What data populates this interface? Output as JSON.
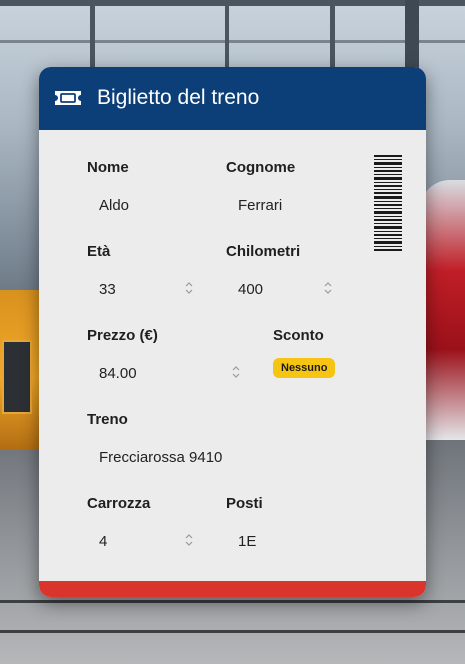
{
  "header": {
    "title": "Biglietto del treno",
    "icon": "ticket-icon"
  },
  "fields": {
    "nome": {
      "label": "Nome",
      "value": "Aldo"
    },
    "cognome": {
      "label": "Cognome",
      "value": "Ferrari"
    },
    "eta": {
      "label": "Età",
      "value": "33"
    },
    "chilometri": {
      "label": "Chilometri",
      "value": "400"
    },
    "prezzo": {
      "label": "Prezzo (€)",
      "value": "84.00"
    },
    "sconto": {
      "label": "Sconto",
      "value": "Nessuno"
    },
    "treno": {
      "label": "Treno",
      "value": "Frecciarossa 9410"
    },
    "carrozza": {
      "label": "Carrozza",
      "value": "4"
    },
    "posti": {
      "label": "Posti",
      "value": "1E"
    }
  },
  "colors": {
    "header": "#0c3f78",
    "footer": "#d9352c",
    "badge": "#f6c513",
    "card": "#ececec"
  }
}
